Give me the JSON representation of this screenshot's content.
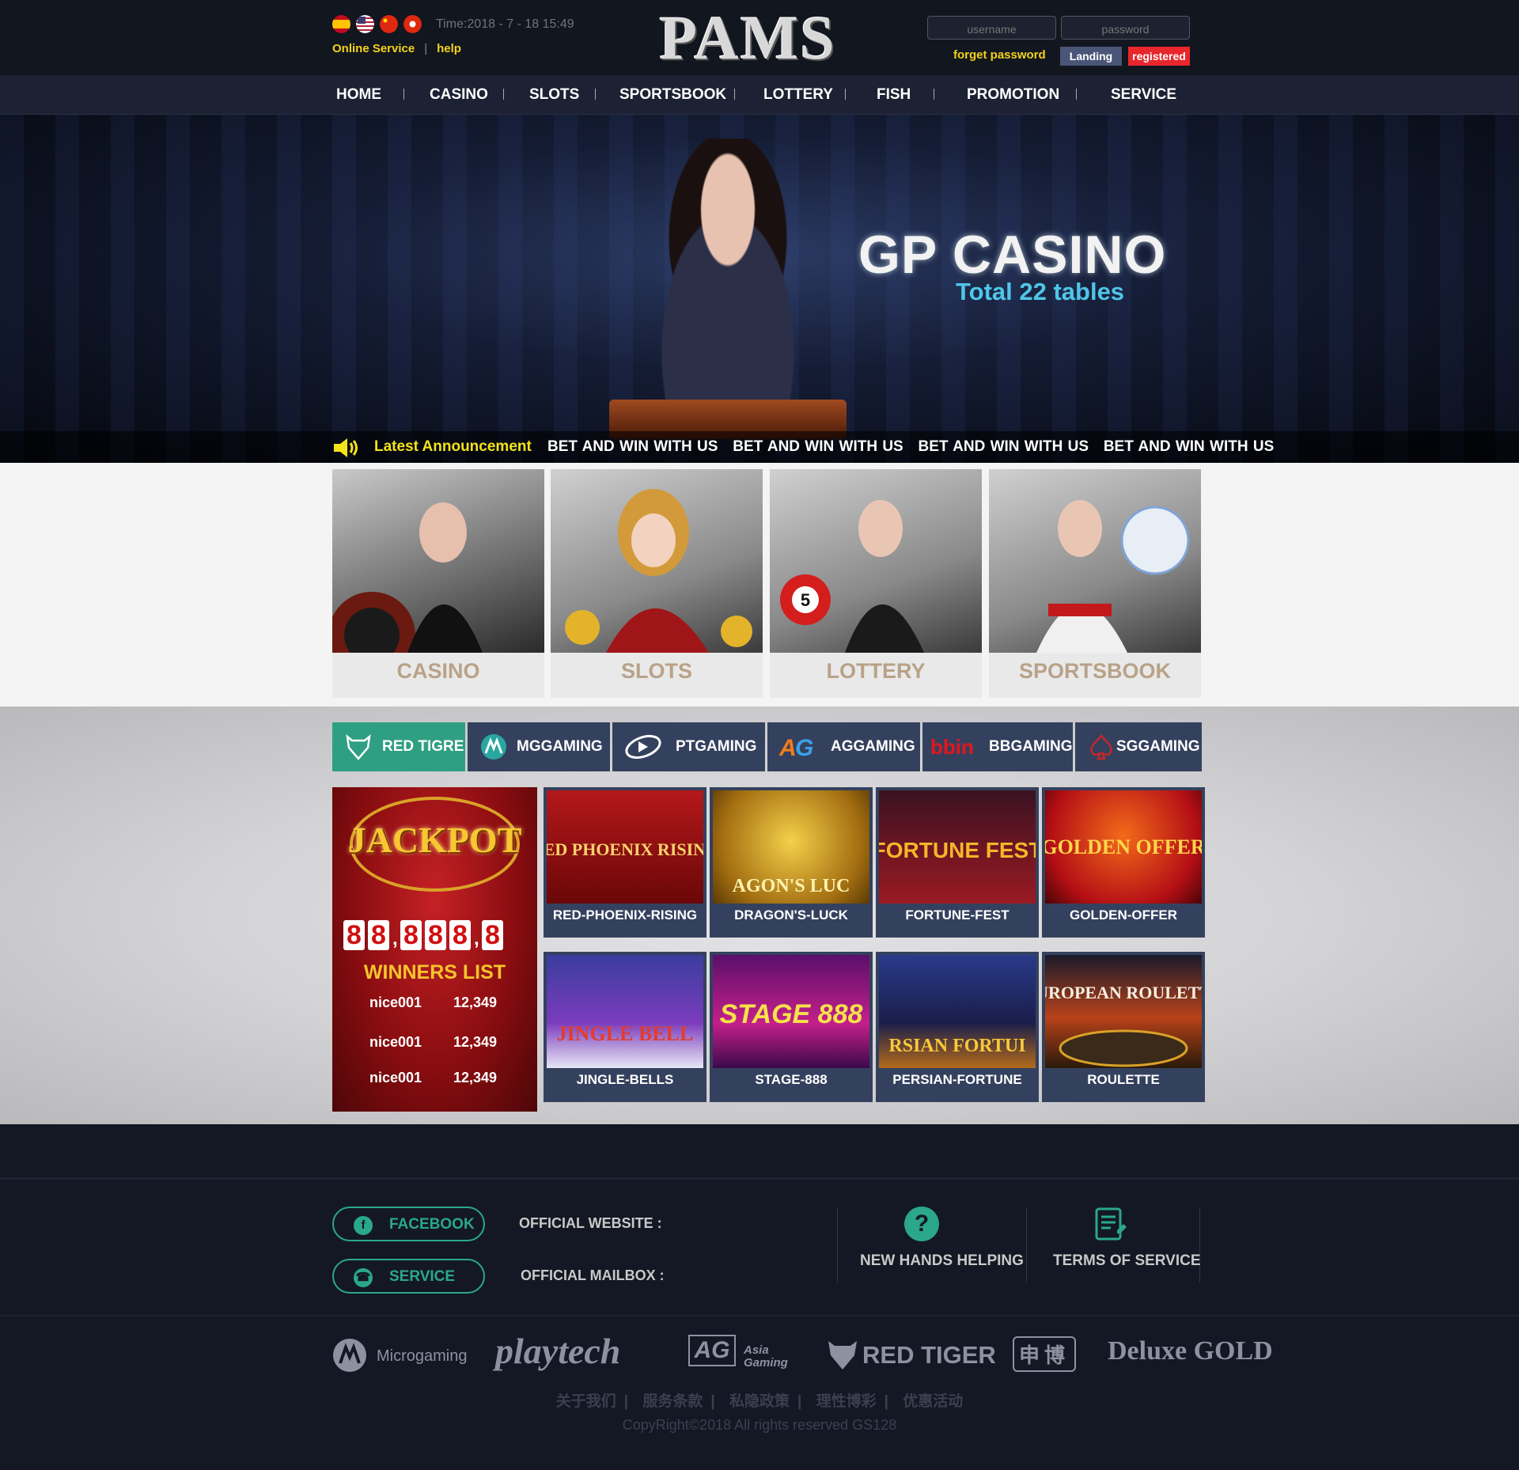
{
  "header": {
    "time": "Time:2018 - 7 - 18  15:49",
    "online_service": "Online Service",
    "help": "help",
    "logo": "PAMS",
    "username_placeholder": "username",
    "password_placeholder": "password",
    "forget_password": "forget password",
    "landing": "Landing",
    "registered": "registered",
    "flags": [
      "spain-flag-icon",
      "usa-flag-icon",
      "china-flag-icon",
      "hongkong-flag-icon"
    ]
  },
  "nav": [
    "HOME",
    "CASINO",
    "SLOTS",
    "SPORTSBOOK",
    "LOTTERY",
    "FISH",
    "PROMOTION",
    "SERVICE"
  ],
  "banner": {
    "title": "GP CASINO",
    "subtitle": "Total 22 tables",
    "announcement_label": "Latest Announcement",
    "announcement_text": "BET AND WIN WITH US   BET AND WIN WITH US   BET AND WIN WITH US   BET AND WIN WITH US"
  },
  "categories": [
    "CASINO",
    "SLOTS",
    "LOTTERY",
    "SPORTSBOOK"
  ],
  "providers": [
    "RED TIGRE",
    "MGGAMING",
    "PTGAMING",
    "AGGAMING",
    "BBGAMING",
    "SGGAMING"
  ],
  "jackpot": {
    "title": "JACKPOT",
    "digits": [
      "8",
      "8",
      ",",
      "8",
      "8",
      "8",
      ",",
      "8"
    ],
    "winners_title": "WINNERS LIST",
    "winners": [
      {
        "name": "nice001",
        "amount": "12,349"
      },
      {
        "name": "nice001",
        "amount": "12,349"
      },
      {
        "name": "nice001",
        "amount": "12,349"
      }
    ]
  },
  "games": [
    {
      "label": "RED-PHOENIX-RISING",
      "art": "RED PHOENIX RISING"
    },
    {
      "label": "DRAGON'S-LUCK",
      "art": "AGON'S LUC"
    },
    {
      "label": "FORTUNE-FEST",
      "art": "FORTUNE FEST"
    },
    {
      "label": "GOLDEN-OFFER",
      "art": "GOLDEN OFFER"
    },
    {
      "label": "JINGLE-BELLS",
      "art": "JINGLE BELL"
    },
    {
      "label": "STAGE-888",
      "art": "STAGE 888"
    },
    {
      "label": "PERSIAN-FORTUNE",
      "art": "RSIAN FORTUI"
    },
    {
      "label": "ROULETTE",
      "art": "EUROPEAN ROULETTE"
    }
  ],
  "footer": {
    "facebook": "FACEBOOK",
    "service": "SERVICE",
    "official_website": "OFFICIAL WEBSITE :",
    "official_mailbox": "OFFICIAL MAILBOX :",
    "new_hands": "NEW HANDS HELPING",
    "terms": "TERMS OF SERVICE",
    "brands": [
      "Microgaming",
      "playtech",
      "Asia Gaming",
      "RED TIGER",
      "申博",
      "Deluxe GOLD"
    ],
    "links": [
      "关于我们",
      "服务条款",
      "私隐政策",
      "理性博彩",
      "优惠活动"
    ],
    "copyright": "CopyRight©2018 All rights reserved GS128"
  },
  "colors": {
    "accent_green": "#2f9f83",
    "register_red": "#e8262c",
    "gold": "#f3d21a"
  }
}
